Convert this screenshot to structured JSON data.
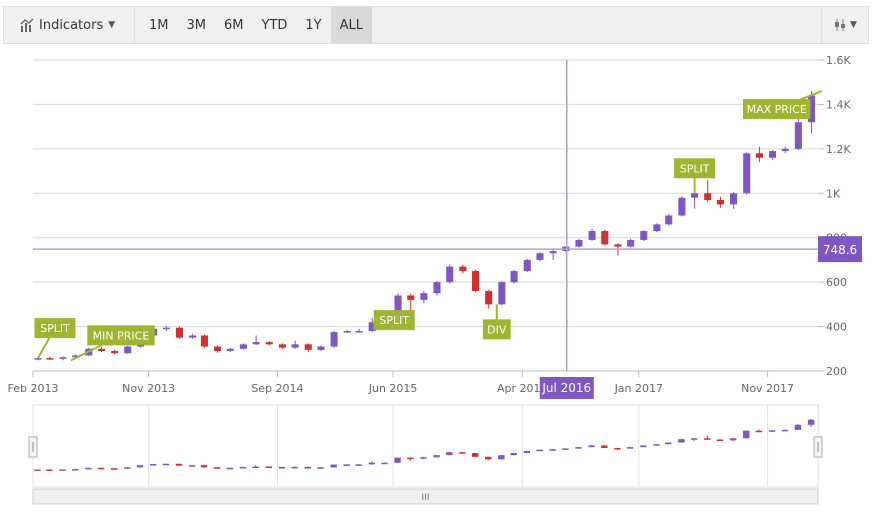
{
  "toolbar": {
    "indicators_label": "Indicators",
    "indicators_icon": "chart-indicators-icon",
    "periods": [
      "1M",
      "3M",
      "6M",
      "YTD",
      "1Y",
      "ALL"
    ],
    "active_period": "ALL",
    "series_type_icon": "candlestick-icon"
  },
  "colors": {
    "up": "#7e57c2",
    "down": "#d32f2f",
    "annotation": "#9fb52f",
    "crosshair": "#7e57c2",
    "grid": "#d6d6d6"
  },
  "chart_data": {
    "type": "candlestick",
    "ylim": [
      200,
      1600
    ],
    "y_ticks": [
      "200",
      "400",
      "600",
      "800",
      "1K",
      "1.2K",
      "1.4K",
      "1.6K"
    ],
    "y_tick_values": [
      200,
      400,
      600,
      800,
      1000,
      1200,
      1400,
      1600
    ],
    "x_range": [
      "2013-02-01",
      "2018-02-28"
    ],
    "x_ticks": [
      {
        "label": "Feb 2013",
        "date": "2013-02-01"
      },
      {
        "label": "Nov 2013",
        "date": "2013-11-01"
      },
      {
        "label": "Sep 2014",
        "date": "2014-09-01"
      },
      {
        "label": "Jun 2015",
        "date": "2015-06-01"
      },
      {
        "label": "Apr 2016",
        "date": "2016-04-01"
      },
      {
        "label": "Jan 2017",
        "date": "2017-01-01"
      },
      {
        "label": "Nov 2017",
        "date": "2017-11-01"
      }
    ],
    "grid": true,
    "crosshair": {
      "x_label": "Jul 2016",
      "x_date": "2016-07-15",
      "y_label": "748.6",
      "y_value": 748.6
    },
    "ohlc": [
      [
        "2013-02-01",
        255,
        262,
        248,
        258
      ],
      [
        "2013-03-01",
        258,
        264,
        250,
        255
      ],
      [
        "2013-04-01",
        255,
        266,
        248,
        262
      ],
      [
        "2013-05-01",
        262,
        275,
        256,
        270
      ],
      [
        "2013-06-01",
        270,
        305,
        266,
        300
      ],
      [
        "2013-07-01",
        300,
        308,
        285,
        290
      ],
      [
        "2013-08-01",
        290,
        296,
        275,
        280
      ],
      [
        "2013-09-01",
        280,
        315,
        276,
        310
      ],
      [
        "2013-10-01",
        310,
        365,
        305,
        360
      ],
      [
        "2013-11-01",
        360,
        392,
        355,
        390
      ],
      [
        "2013-12-01",
        390,
        402,
        380,
        395
      ],
      [
        "2014-01-01",
        395,
        400,
        345,
        350
      ],
      [
        "2014-02-01",
        350,
        368,
        345,
        360
      ],
      [
        "2014-03-01",
        360,
        365,
        305,
        310
      ],
      [
        "2014-04-01",
        310,
        315,
        282,
        290
      ],
      [
        "2014-05-01",
        290,
        304,
        285,
        300
      ],
      [
        "2014-06-01",
        300,
        325,
        296,
        320
      ],
      [
        "2014-07-01",
        320,
        360,
        316,
        330
      ],
      [
        "2014-08-01",
        330,
        335,
        315,
        320
      ],
      [
        "2014-09-01",
        320,
        325,
        298,
        305
      ],
      [
        "2014-10-01",
        305,
        336,
        300,
        320
      ],
      [
        "2014-11-01",
        320,
        325,
        285,
        295
      ],
      [
        "2014-12-01",
        295,
        315,
        290,
        310
      ],
      [
        "2015-01-01",
        310,
        380,
        305,
        375
      ],
      [
        "2015-02-01",
        375,
        385,
        370,
        380
      ],
      [
        "2015-03-01",
        380,
        390,
        372,
        380
      ],
      [
        "2015-04-01",
        380,
        440,
        376,
        420
      ],
      [
        "2015-05-01",
        420,
        430,
        412,
        420
      ],
      [
        "2015-06-01",
        420,
        550,
        416,
        540
      ],
      [
        "2015-07-01",
        540,
        548,
        470,
        520
      ],
      [
        "2015-08-01",
        520,
        560,
        505,
        550
      ],
      [
        "2015-09-01",
        550,
        605,
        540,
        600
      ],
      [
        "2015-10-01",
        600,
        680,
        595,
        670
      ],
      [
        "2015-11-01",
        670,
        678,
        640,
        650
      ],
      [
        "2015-12-01",
        650,
        655,
        555,
        560
      ],
      [
        "2016-01-01",
        560,
        565,
        480,
        500
      ],
      [
        "2016-02-01",
        500,
        605,
        495,
        600
      ],
      [
        "2016-03-01",
        600,
        655,
        595,
        650
      ],
      [
        "2016-04-01",
        650,
        705,
        645,
        700
      ],
      [
        "2016-05-01",
        700,
        735,
        695,
        730
      ],
      [
        "2016-06-01",
        730,
        748,
        700,
        740
      ],
      [
        "2016-07-01",
        740,
        762,
        735,
        760
      ],
      [
        "2016-08-01",
        760,
        795,
        755,
        790
      ],
      [
        "2016-09-01",
        790,
        840,
        785,
        830
      ],
      [
        "2016-10-01",
        830,
        835,
        765,
        770
      ],
      [
        "2016-11-01",
        770,
        775,
        720,
        760
      ],
      [
        "2016-12-01",
        760,
        795,
        755,
        790
      ],
      [
        "2017-01-01",
        790,
        835,
        785,
        830
      ],
      [
        "2017-02-01",
        830,
        865,
        825,
        860
      ],
      [
        "2017-03-01",
        860,
        905,
        855,
        900
      ],
      [
        "2017-04-01",
        900,
        985,
        895,
        980
      ],
      [
        "2017-05-01",
        980,
        1005,
        930,
        1000
      ],
      [
        "2017-06-01",
        1000,
        1060,
        960,
        970
      ],
      [
        "2017-07-01",
        970,
        985,
        935,
        950
      ],
      [
        "2017-08-01",
        950,
        1005,
        930,
        1000
      ],
      [
        "2017-09-01",
        1000,
        1185,
        995,
        1180
      ],
      [
        "2017-10-01",
        1180,
        1210,
        1140,
        1160
      ],
      [
        "2017-11-01",
        1160,
        1195,
        1150,
        1190
      ],
      [
        "2017-12-01",
        1190,
        1210,
        1180,
        1200
      ],
      [
        "2018-01-01",
        1200,
        1340,
        1195,
        1320
      ],
      [
        "2018-02-01",
        1320,
        1460,
        1270,
        1440
      ]
    ],
    "annotations": [
      {
        "text": "SPLIT",
        "date": "2013-02-01",
        "value": 258
      },
      {
        "text": "MIN PRICE",
        "date": "2013-04-20",
        "value": 248
      },
      {
        "text": "SPLIT",
        "date": "2015-04-01",
        "value": 420
      },
      {
        "text": "DIV",
        "date": "2016-01-20",
        "value": 500
      },
      {
        "text": "SPLIT",
        "date": "2017-05-01",
        "value": 1000
      },
      {
        "text": "MAX PRICE",
        "date": "2018-02-25",
        "value": 1460
      }
    ]
  },
  "navigator": {
    "scrollbar_grip": "III"
  }
}
